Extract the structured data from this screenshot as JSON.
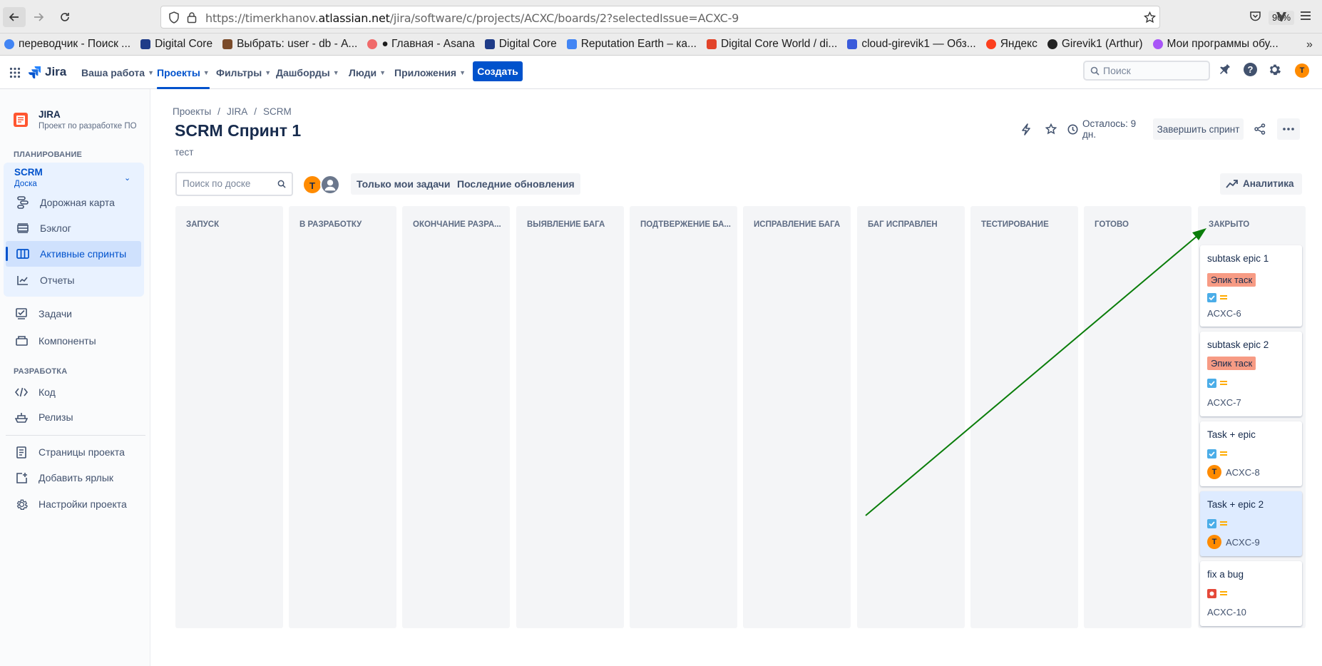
{
  "browser": {
    "url_prefix": "https://timerkhanov.",
    "url_domain": "atlassian.net",
    "url_path": "/jira/software/c/projects/ACXC/boards/2?selectedIssue=ACXC-9",
    "zoom": "90%",
    "bookmarks": [
      {
        "label": "переводчик - Поиск ...",
        "color": "#4285f4"
      },
      {
        "label": "Digital Core",
        "color": "#1f3c88"
      },
      {
        "label": "Выбрать: user - db - А...",
        "color": "#7a4b2a"
      },
      {
        "label": "● Главная - Asana",
        "color": "#f06a6a"
      },
      {
        "label": "Digital Core",
        "color": "#1f3c88"
      },
      {
        "label": "Reputation Earth – ка...",
        "color": "#4285f4"
      },
      {
        "label": "Digital Core World / di...",
        "color": "#e24329"
      },
      {
        "label": "cloud-girevik1 — Обз...",
        "color": "#3b5bdb"
      },
      {
        "label": "Яндекс",
        "color": "#fc3f1d"
      },
      {
        "label": "Girevik1 (Arthur)",
        "color": "#222222"
      },
      {
        "label": "Мои программы обу...",
        "color": "#a855f7"
      }
    ]
  },
  "nav": {
    "logo": "Jira",
    "items": [
      "Ваша работа",
      "Проекты",
      "Фильтры",
      "Дашборды",
      "Люди",
      "Приложения"
    ],
    "create": "Создать",
    "search_placeholder": "Поиск",
    "avatar": "T"
  },
  "sidebar": {
    "project_name": "JIRA",
    "project_type": "Проект по разработке ПО",
    "planning_heading": "ПЛАНИРОВАНИЕ",
    "board_name": "SCRM",
    "board_sub": "Доска",
    "planning_items": [
      "Дорожная карта",
      "Бэклог",
      "Активные спринты",
      "Отчеты"
    ],
    "items": [
      "Задачи",
      "Компоненты"
    ],
    "dev_heading": "РАЗРАБОТКА",
    "dev_items": [
      "Код",
      "Релизы"
    ],
    "footer_items": [
      "Страницы проекта",
      "Добавить ярлык",
      "Настройки проекта"
    ]
  },
  "main": {
    "breadcrumb": [
      "Проекты",
      "JIRA",
      "SCRM"
    ],
    "title": "SCRM Спринт 1",
    "goal": "тест",
    "remaining": "Осталось: 9 дн.",
    "complete_sprint": "Завершить спринт",
    "search_placeholder": "Поиск по доске",
    "avatar": "T",
    "filters": [
      "Только мои задачи",
      "Последние обновления"
    ],
    "analytics": "Аналитика"
  },
  "columns": [
    "ЗАПУСК",
    "В РАЗРАБОТКУ",
    "ОКОНЧАНИЕ РАЗРА...",
    "ВЫЯВЛЕНИЕ БАГА",
    "ПОДТВЕРЖЕНИЕ БА...",
    "ИСПРАВЛЕНИЕ БАГА",
    "БАГ ИСПРАВЛЕН",
    "ТЕСТИРОВАНИЕ",
    "ГОТОВО",
    "ЗАКРЫТО"
  ],
  "cards": [
    {
      "title": "subtask epic 1",
      "label": "Эпик таск",
      "type": "task",
      "key": "ACXC-6",
      "assignee": ""
    },
    {
      "title": "subtask epic 2",
      "label": "Эпик таск",
      "type": "task",
      "key": "ACXC-7",
      "assignee": ""
    },
    {
      "title": "Task + epic",
      "label": "",
      "type": "task",
      "key": "ACXC-8",
      "assignee": "T"
    },
    {
      "title": "Task + epic 2",
      "label": "",
      "type": "task",
      "key": "ACXC-9",
      "assignee": "T"
    },
    {
      "title": "fix a bug",
      "label": "",
      "type": "bug",
      "key": "ACXC-10",
      "assignee": ""
    }
  ],
  "colors": {
    "accent": "#0052cc",
    "annotation_arrow": "#0a7d0a",
    "epic_label": "#f79b84",
    "avatar": "#ff8b00"
  }
}
